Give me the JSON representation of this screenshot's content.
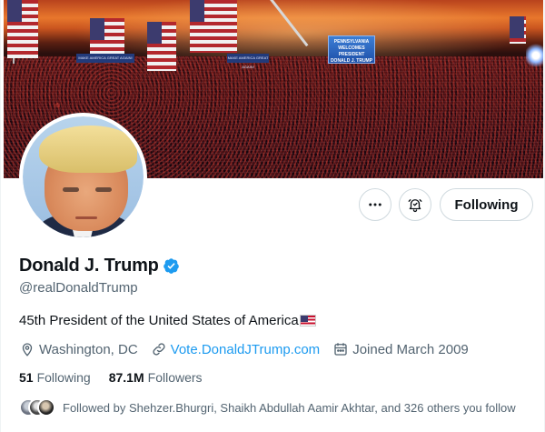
{
  "profile": {
    "name": "Donald J. Trump",
    "handle": "@realDonaldTrump",
    "bio": "45th President of the United States of America",
    "location": "Washington, DC",
    "website": "Vote.DonaldJTrump.com",
    "joined": "Joined March 2009",
    "following_count": "51",
    "following_label": "Following",
    "followers_count": "87.1M",
    "followers_label": "Followers",
    "followed_by": "Followed by Shehzer.Bhurgri, Shaikh Abdullah Aamir Akhtar, and 326 others you follow"
  },
  "actions": {
    "more_icon": "more-horizontal-icon",
    "notify_icon": "notification-bell-icon",
    "follow_label": "Following"
  },
  "banner": {
    "screen_text": "PENNSYLVANIA WELCOMES PRESIDENT DONALD J. TRUMP",
    "sign_left": "MAKE AMERICA GREAT AGAIN!",
    "sign_right": "MAKE AMERICA GREAT AGAIN!"
  },
  "colors": {
    "accent": "#1d9bf0",
    "secondary_text": "#536471",
    "primary_text": "#0f1419",
    "border": "#cfd9de"
  }
}
